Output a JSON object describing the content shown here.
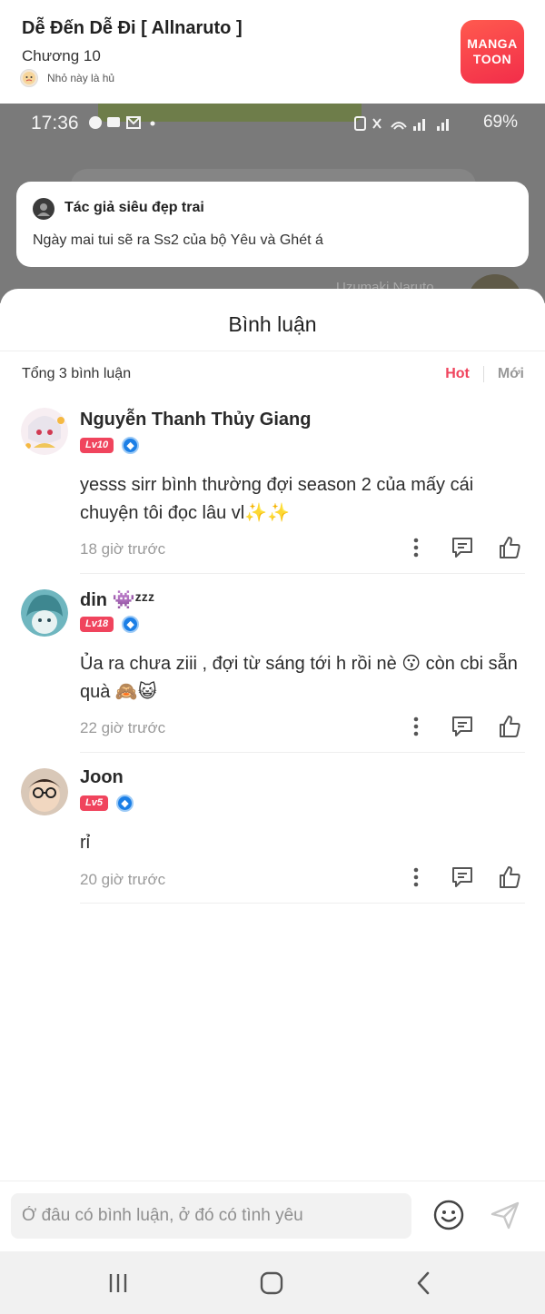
{
  "header": {
    "story_title": "Dễ Đến Dễ Đi [ Allnaruto ]",
    "chapter": "Chương 10",
    "author": "Nhỏ này là hủ",
    "logo_line1": "MANGA",
    "logo_line2": "TOON"
  },
  "backdrop": {
    "time": "17:36",
    "battery": "69%",
    "ghost_name": "Uzumaki Naruto"
  },
  "note": {
    "author": "Tác giả siêu đẹp trai",
    "text": "Ngày mai tui sẽ ra Ss2 của bộ Yêu và Ghét á"
  },
  "comments_panel": {
    "title": "Bình luận",
    "total": "Tổng 3 bình luận",
    "sort_hot": "Hot",
    "sort_new": "Mới",
    "comments": [
      {
        "name": "Nguyễn Thanh Thủy Giang",
        "level": "Lv10",
        "text": "yesss sirr bình thường đợi season 2 của mấy cái chuyện tôi đọc lâu vl✨✨",
        "time": "18 giờ trước"
      },
      {
        "name": "din 👾ᶻᶻᶻ",
        "level": "Lv18",
        "text": "Ủa ra chưa ziii , đợi từ sáng tới h rồi nè 😗 còn cbi sẵn quà 🙈😺",
        "time": "22 giờ trước"
      },
      {
        "name": "Joon",
        "level": "Lv5",
        "text": "rỉ",
        "time": "20 giờ trước"
      }
    ]
  },
  "composer": {
    "placeholder": "Ở đâu có bình luận, ở đó có tình yêu"
  },
  "colors": {
    "accent": "#f0445d",
    "logo": "#f22d4a",
    "badge_blue": "#1c7fe6"
  },
  "icons": [
    "more-vertical-icon",
    "reply-icon",
    "thumbs-up-icon",
    "emoji-icon",
    "send-icon",
    "recent-apps-icon",
    "home-icon",
    "back-icon"
  ]
}
